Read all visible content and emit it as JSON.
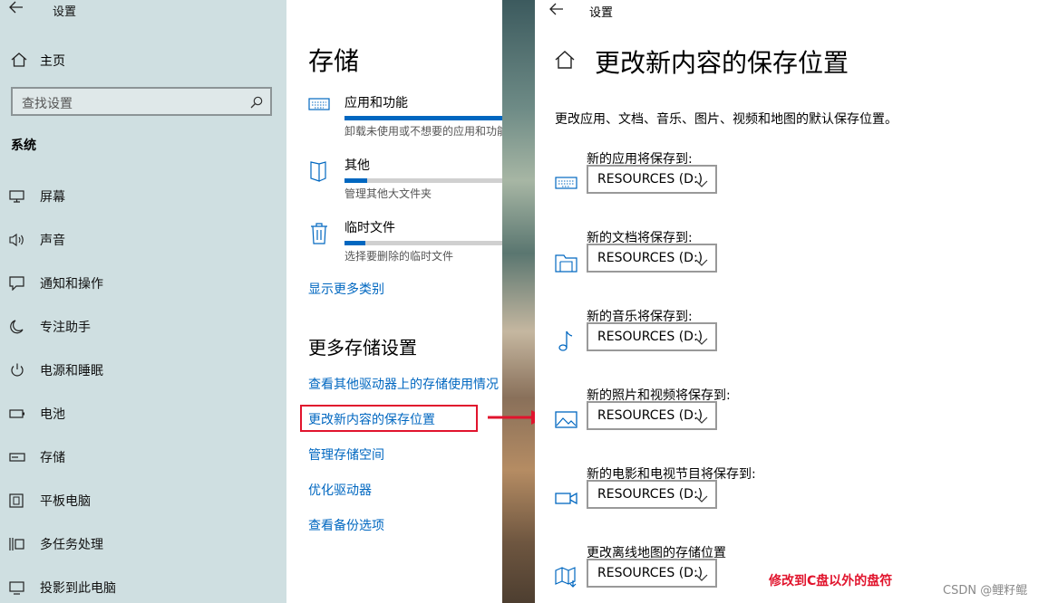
{
  "nav": {
    "window_title": "设置",
    "home_label": "主页",
    "search_placeholder": "查找设置",
    "section": "系统",
    "items": [
      {
        "label": "屏幕",
        "icon": "display-icon"
      },
      {
        "label": "声音",
        "icon": "speaker-icon"
      },
      {
        "label": "通知和操作",
        "icon": "notification-icon"
      },
      {
        "label": "专注助手",
        "icon": "moon-icon"
      },
      {
        "label": "电源和睡眠",
        "icon": "power-icon"
      },
      {
        "label": "电池",
        "icon": "battery-icon"
      },
      {
        "label": "存储",
        "icon": "storage-icon"
      },
      {
        "label": "平板电脑",
        "icon": "tablet-icon"
      },
      {
        "label": "多任务处理",
        "icon": "multitask-icon"
      },
      {
        "label": "投影到此电脑",
        "icon": "project-icon"
      }
    ]
  },
  "storage": {
    "title": "存储",
    "categories": [
      {
        "name": "应用和功能",
        "desc": "卸载未使用或不想要的应用和功能",
        "usage_fraction": 1.0,
        "icon": "keyboard-icon"
      },
      {
        "name": "其他",
        "desc": "管理其他大文件夹",
        "usage_fraction": 0.14,
        "icon": "folder-icon"
      },
      {
        "name": "临时文件",
        "desc": "选择要删除的临时文件",
        "usage_fraction": 0.13,
        "icon": "trash-icon"
      }
    ],
    "show_more": "显示更多类别",
    "more_title": "更多存储设置",
    "links": [
      "查看其他驱动器上的存储使用情况",
      "更改新内容的保存位置",
      "管理存储空间",
      "优化驱动器",
      "查看备份选项"
    ]
  },
  "detail": {
    "window_title": "设置",
    "title": "更改新内容的保存位置",
    "intro": "更改应用、文档、音乐、图片、视频和地图的默认保存位置。",
    "slots": [
      {
        "label": "新的应用将保存到:",
        "value": "RESOURCES (D:)",
        "icon": "apps-icon"
      },
      {
        "label": "新的文档将保存到:",
        "value": "RESOURCES (D:)",
        "icon": "documents-icon"
      },
      {
        "label": "新的音乐将保存到:",
        "value": "RESOURCES (D:)",
        "icon": "music-icon"
      },
      {
        "label": "新的照片和视频将保存到:",
        "value": "RESOURCES (D:)",
        "icon": "photo-icon"
      },
      {
        "label": "新的电影和电视节目将保存到:",
        "value": "RESOURCES (D:)",
        "icon": "video-icon"
      },
      {
        "label": "更改离线地图的存储位置",
        "value": "RESOURCES (D:)",
        "icon": "map-icon"
      }
    ],
    "annotation": "修改到C盘以外的盘符"
  },
  "watermark": "CSDN @鲤籽鲲",
  "colors": {
    "accent": "#0067c0",
    "annotation": "#e1142d",
    "nav_bg": "#cfdfe1"
  }
}
